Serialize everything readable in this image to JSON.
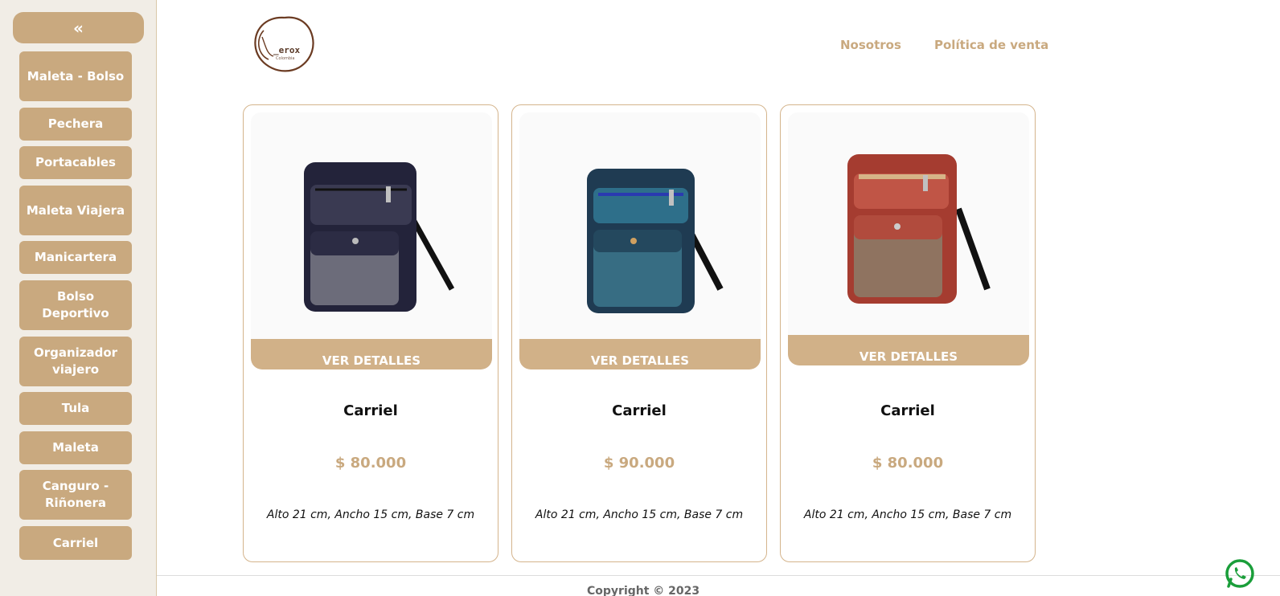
{
  "sidebar": {
    "collapse_label": "«",
    "items": [
      {
        "label": "Maleta - Bolso"
      },
      {
        "label": "Pechera"
      },
      {
        "label": "Portacables"
      },
      {
        "label": "Maleta Viajera"
      },
      {
        "label": "Manicartera"
      },
      {
        "label": "Bolso Deportivo"
      },
      {
        "label": "Organizador viajero"
      },
      {
        "label": "Tula"
      },
      {
        "label": "Maleta"
      },
      {
        "label": "Canguro - Riñonera"
      },
      {
        "label": "Carriel"
      }
    ]
  },
  "header": {
    "logo_text": "_erox",
    "logo_subtext": "Colombia",
    "nav": [
      {
        "label": "Nosotros"
      },
      {
        "label": "Política de venta"
      }
    ]
  },
  "products": [
    {
      "details_label": "VER DETALLES",
      "title": "Carriel",
      "price": "$ 80.000",
      "description": "Alto 21 cm, Ancho 15 cm, Base 7 cm",
      "bag_color": "#23233a",
      "accent_color": "#3a3a52"
    },
    {
      "details_label": "VER DETALLES",
      "title": "Carriel",
      "price": "$ 90.000",
      "description": "Alto 21 cm, Ancho 15 cm, Base 7 cm",
      "bag_color": "#1f3b52",
      "accent_color": "#2e6f8a"
    },
    {
      "details_label": "VER DETALLES",
      "title": "Carriel",
      "price": "$ 80.000",
      "description": "Alto 21 cm, Ancho 15 cm, Base 7 cm",
      "bag_color": "#a53c30",
      "accent_color": "#c05546"
    }
  ],
  "footer": {
    "copyright": "Copyright © 2023"
  },
  "colors": {
    "accent": "#c9a97f",
    "sidebar_bg": "#f1ede6",
    "whatsapp": "#1a9e3a"
  }
}
